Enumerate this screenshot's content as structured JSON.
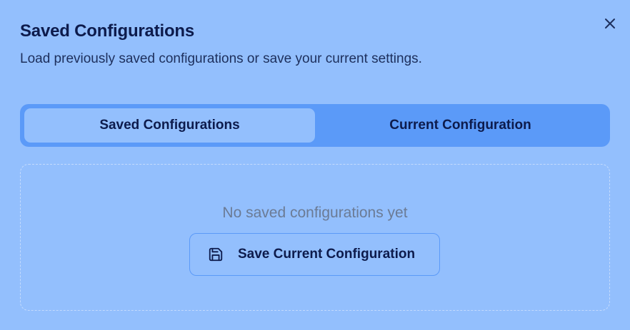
{
  "dialog": {
    "title": "Saved Configurations",
    "subtitle": "Load previously saved configurations or save your current settings.",
    "close_icon": "close-icon"
  },
  "tabs": [
    {
      "label": "Saved Configurations",
      "active": true
    },
    {
      "label": "Current Configuration",
      "active": false
    }
  ],
  "saved_panel": {
    "empty_text": "No saved configurations yet",
    "save_button_label": "Save Current Configuration",
    "save_icon": "floppy-disk-icon"
  },
  "colors": {
    "background": "#93bffd",
    "tab_track": "#5b9af8",
    "text_primary": "#0d1b4c",
    "text_muted": "#6b7b95"
  }
}
